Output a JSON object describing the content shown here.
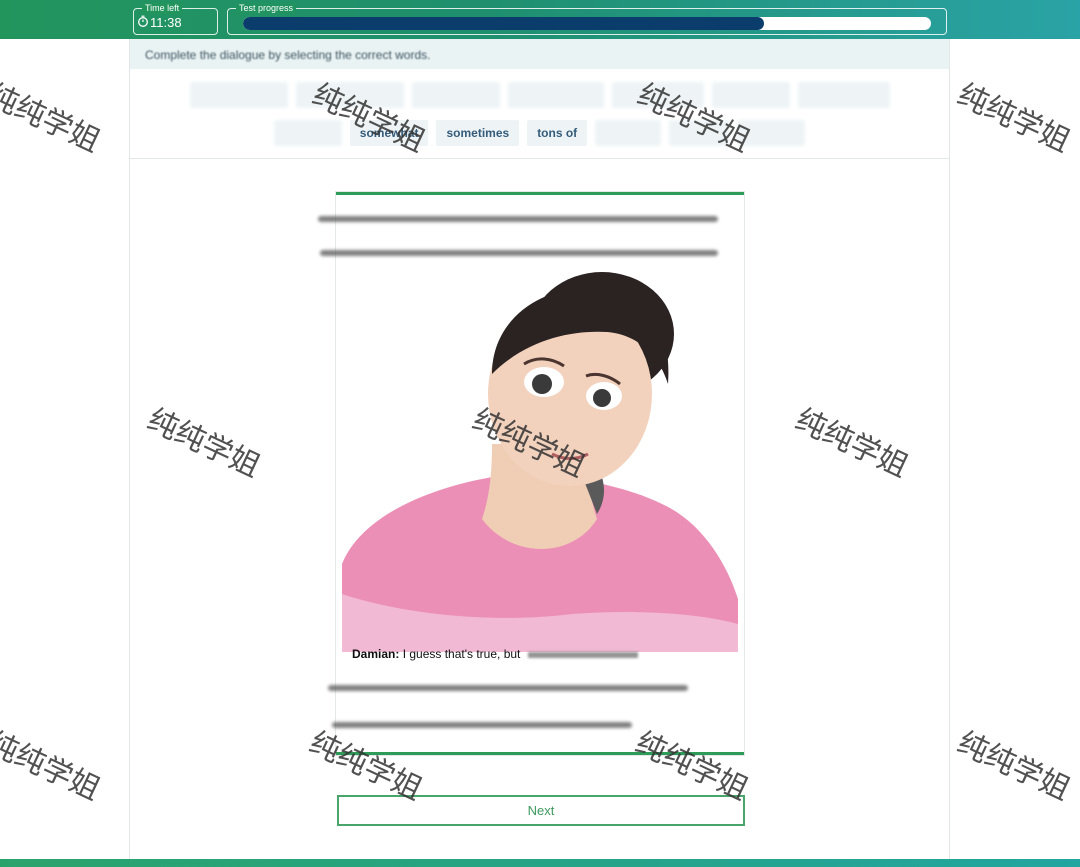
{
  "header": {
    "timer": {
      "legend": "Time left",
      "value": "11:38"
    },
    "progress": {
      "legend": "Test progress",
      "fraction": 0.757
    }
  },
  "instruction": "Complete the dialogue by selecting the correct words.",
  "chips": {
    "row1": [
      "",
      "",
      "",
      "",
      "",
      "",
      ""
    ],
    "row2": [
      "",
      "somewhat",
      "sometimes",
      "tons of",
      "",
      "",
      ""
    ]
  },
  "dialogue": {
    "speaker": "Damian:",
    "line": "I guess that's true, but"
  },
  "next_label": "Next",
  "watermark": "纯纯学姐",
  "colors": {
    "brand_green": "#22955d",
    "progress_fill": "#0a3d6b",
    "button_border": "#4aa56c"
  }
}
